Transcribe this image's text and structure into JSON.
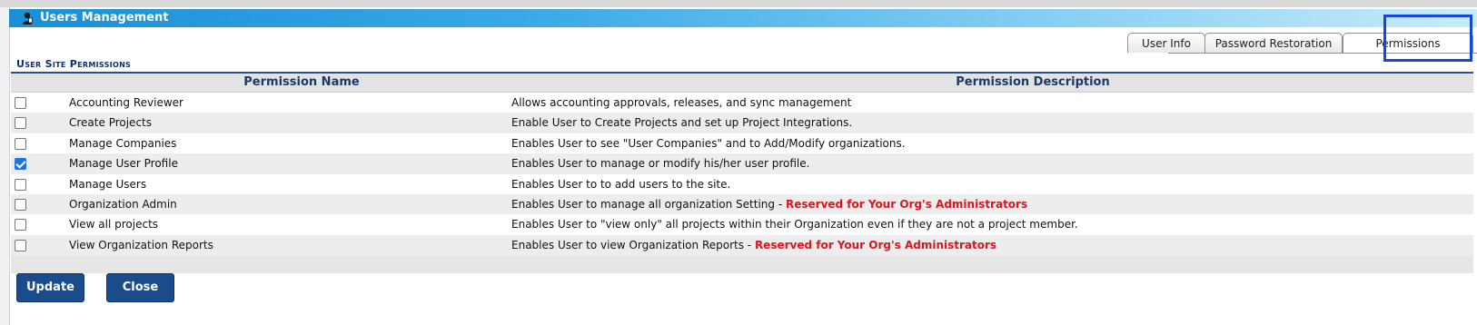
{
  "window": {
    "title": "Users Management",
    "icon": "user-admin-icon"
  },
  "tabs": [
    {
      "label": "User Info",
      "active": false
    },
    {
      "label": "Password Restoration",
      "active": false
    },
    {
      "label": "Permissions",
      "active": true
    }
  ],
  "section": {
    "title": "User Site Permissions"
  },
  "table": {
    "headers": {
      "name": "Permission Name",
      "description": "Permission Description"
    },
    "rows": [
      {
        "checked": false,
        "name": "Accounting Reviewer",
        "description": "Allows accounting approvals, releases, and sync management",
        "warning": ""
      },
      {
        "checked": false,
        "name": "Create Projects",
        "description": "Enable User to Create Projects and set up Project Integrations.",
        "warning": ""
      },
      {
        "checked": false,
        "name": "Manage Companies",
        "description": "Enables User to see \"User Companies\" and to Add/Modify organizations.",
        "warning": ""
      },
      {
        "checked": true,
        "name": "Manage User Profile",
        "description": "Enables User to manage or modify his/her user profile.",
        "warning": ""
      },
      {
        "checked": false,
        "name": "Manage Users",
        "description": "Enables User to to add users to the site.",
        "warning": ""
      },
      {
        "checked": false,
        "name": "Organization Admin",
        "description": "Enables User to manage all organization Setting - ",
        "warning": "Reserved for Your Org's Administrators"
      },
      {
        "checked": false,
        "name": "View all projects",
        "description": "Enables User to \"view only\" all projects within their Organization even if they are not a project member.",
        "warning": ""
      },
      {
        "checked": false,
        "name": "View Organization Reports",
        "description": "Enables User to view Organization Reports - ",
        "warning": "Reserved for Your Org's Administrators"
      }
    ]
  },
  "buttons": {
    "update": "Update",
    "close": "Close"
  },
  "colors": {
    "accent": "#1a4c8c",
    "warning": "#e0141e",
    "header_text": "#1b3a6b",
    "highlight": "#1747d6"
  }
}
